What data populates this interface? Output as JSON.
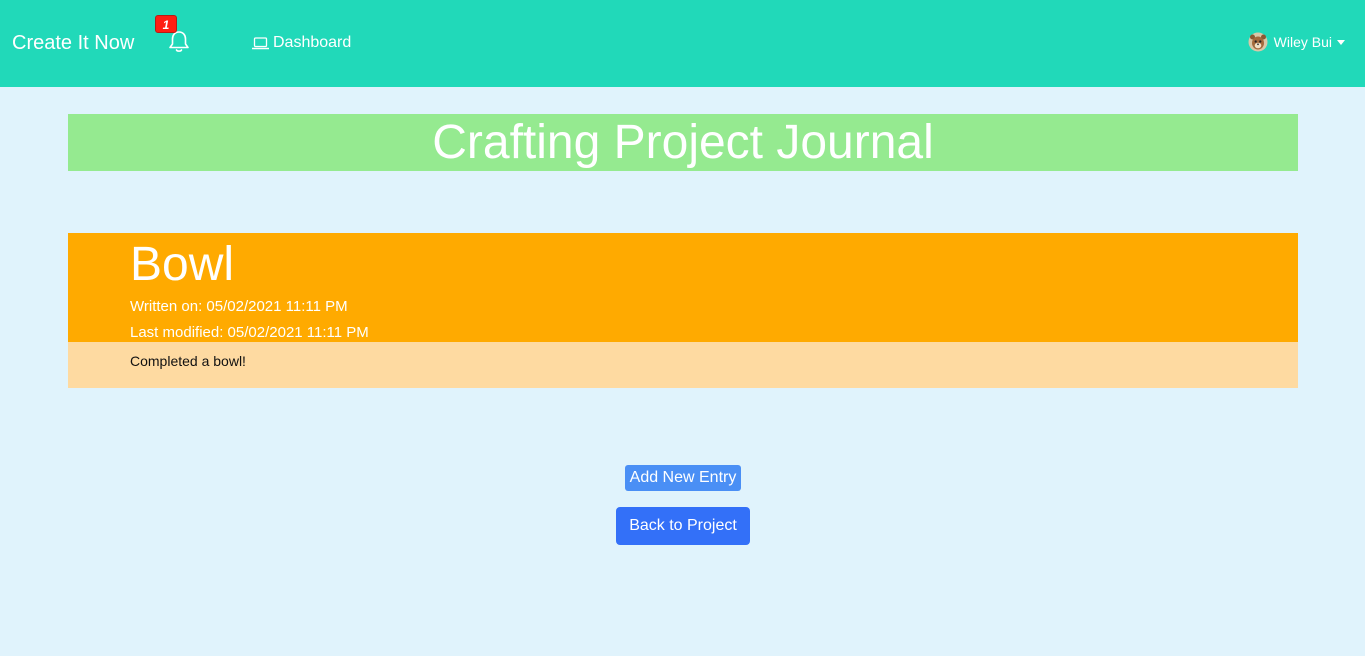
{
  "navbar": {
    "brand": "Create It Now",
    "notification_count": "1",
    "dashboard_label": "Dashboard",
    "user_name": "Wiley Bui",
    "bell_icon": "bell-icon",
    "dashboard_icon": "laptop-icon",
    "background_color": "#21d9b9"
  },
  "page": {
    "title": "Crafting Project Journal",
    "title_bg": "#95ea90"
  },
  "entry": {
    "title": "Bowl",
    "written_on": "Written on: 05/02/2021 11:11 PM",
    "last_modified": "Last modified: 05/02/2021 11:11 PM",
    "body": "Completed a bowl!",
    "header_bg": "#ffaa00",
    "body_bg": "#fedaa1"
  },
  "actions": {
    "add_entry_label": "Add New Entry",
    "back_label": "Back to Project"
  }
}
